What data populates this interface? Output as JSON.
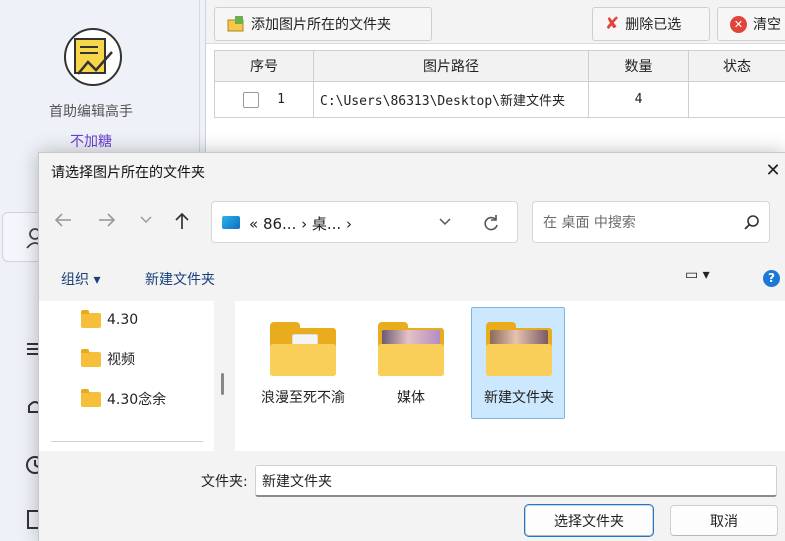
{
  "app": {
    "name": "首助编辑高手",
    "subtitle": "不加糖",
    "toolbar": {
      "add_folder_label": "添加图片所在的文件夹",
      "delete_selected_label": "删除已选",
      "clear_label": "清空"
    },
    "table": {
      "headers": [
        "序号",
        "图片路径",
        "数量",
        "状态"
      ],
      "rows": [
        {
          "index": "1",
          "path": "C:\\Users\\86313\\Desktop\\新建文件夹",
          "count": "4",
          "status": ""
        }
      ]
    }
  },
  "dialog": {
    "title": "请选择图片所在的文件夹",
    "close_glyph": "✕",
    "address": {
      "breadcrumb": "« 86... › 桌... ›"
    },
    "search": {
      "placeholder": "在 桌面 中搜索"
    },
    "commands": {
      "organize_label": "组织 ▾",
      "new_folder_label": "新建文件夹",
      "view_glyph": "▭ ▾",
      "help_glyph": "?"
    },
    "nav_items": [
      {
        "label": "4.30"
      },
      {
        "label": "视频"
      },
      {
        "label": "4.30念余"
      }
    ],
    "files": [
      {
        "name": "浪漫至死不渝",
        "thumbnail": "document"
      },
      {
        "name": "媒体",
        "thumbnail": "anime-photo"
      },
      {
        "name": "新建文件夹",
        "thumbnail": "anime-photo",
        "selected": true
      }
    ],
    "filename_label": "文件夹:",
    "filename_value": "新建文件夹",
    "select_button_label": "选择文件夹",
    "cancel_button_label": "取消"
  },
  "colors": {
    "accent": "#1a78d6",
    "selection": "#cce8ff",
    "folder": "#f9cf5a",
    "subtitle": "#6a3fd0"
  }
}
